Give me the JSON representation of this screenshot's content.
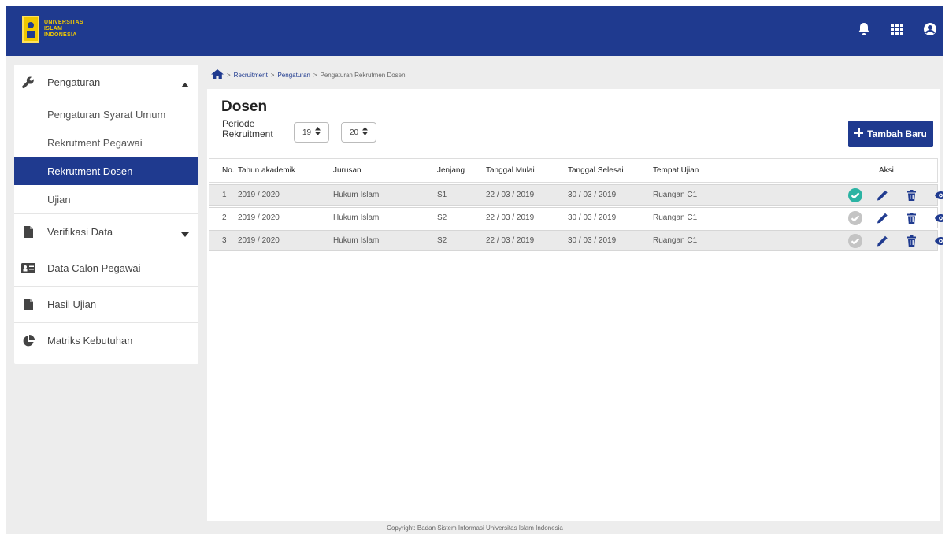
{
  "header": {
    "logo_lines": [
      "UNIVERSITAS",
      "ISLAM",
      "INDONESIA"
    ],
    "icons": [
      "bell-icon",
      "grid-icon",
      "account-icon"
    ]
  },
  "sidebar": {
    "sections": [
      {
        "label": "Pengaturan",
        "icon": "wrench-icon",
        "caret": "up"
      },
      {
        "label": "Verifikasi Data",
        "icon": "document-icon",
        "caret": "down"
      },
      {
        "label": "Data Calon Pegawai",
        "icon": "id-card-icon"
      },
      {
        "label": "Hasil Ujian",
        "icon": "file-icon"
      },
      {
        "label": "Matriks Kebutuhan",
        "icon": "pie-chart-icon"
      }
    ],
    "sub_items": [
      "Pengaturan Syarat Umum",
      "Rekrutment Pegawai",
      "Rekrutment Dosen",
      "Ujian"
    ],
    "active_sub_item": "Rekrutment Dosen"
  },
  "breadcrumb": {
    "home_icon": "home-icon",
    "separator": ">",
    "items": [
      "Recruitment",
      "Pengaturan",
      "Pengaturan Rekrutmen Dosen"
    ]
  },
  "main": {
    "title": "Dosen",
    "periode_label_1": "Periode",
    "periode_label_2": "Rekruitment",
    "periode_from": "19",
    "periode_to": "20",
    "add_button": "Tambah Baru"
  },
  "table": {
    "headers": [
      "No.",
      "Tahun akademik",
      "Jurusan",
      "Jenjang",
      "Tanggal Mulai",
      "Tanggal Selesai",
      "Tempat Ujian",
      "Aksi"
    ],
    "rows": [
      {
        "no": "1",
        "tahun": "2019 / 2020",
        "jurusan": "Hukum Islam",
        "jenjang": "S1",
        "mulai": "22 / 03 / 2019",
        "selesai": "30 / 03 / 2019",
        "tempat": "Ruangan C1",
        "status": "active"
      },
      {
        "no": "2",
        "tahun": "2019 / 2020",
        "jurusan": "Hukum Islam",
        "jenjang": "S2",
        "mulai": "22 / 03 / 2019",
        "selesai": "30 / 03 / 2019",
        "tempat": "Ruangan C1",
        "status": "inactive"
      },
      {
        "no": "3",
        "tahun": "2019 / 2020",
        "jurusan": "Hukum Islam",
        "jenjang": "S2",
        "mulai": "22 / 03 / 2019",
        "selesai": "30 / 03 / 2019",
        "tempat": "Ruangan C1",
        "status": "inactive"
      }
    ],
    "action_icons": [
      "check-circle-icon",
      "pencil-icon",
      "trash-icon",
      "eye-icon"
    ]
  },
  "footer": {
    "copyright": "Copyright: Badan Sistem Informasi Universitas Islam Indonesia"
  },
  "colors": {
    "brand": "#1f3a8f",
    "logo_gold": "#f0c800",
    "status_active": "#2bb3a3",
    "status_inactive": "#c4c4c4"
  }
}
